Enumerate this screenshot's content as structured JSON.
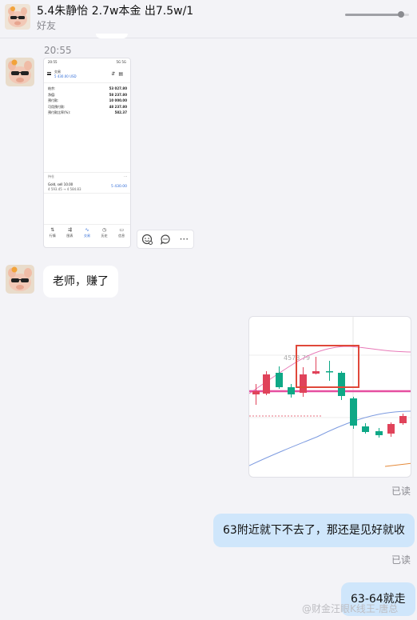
{
  "header": {
    "name": "5.4朱静怡 2.7w本金 出7.5w/1",
    "subtitle": "好友",
    "scroll_fraction": 0.88
  },
  "messages": {
    "time": "20:55",
    "reply_1": "老师，赚了",
    "reply_2": "63附近就下不去了，那还是见好就收",
    "reply_3": "63-64就走",
    "read_status_1": "已读",
    "read_status_2": "已读"
  },
  "phone_screenshot": {
    "status_time": "20:55",
    "status_right": "5G 5G",
    "title": "交易",
    "balance": "5 430.00 USD",
    "rows": [
      {
        "label": "结余:",
        "value": "53 027.80"
      },
      {
        "label": "净值:",
        "value": "58 237.80"
      },
      {
        "label": "预付款:",
        "value": "10 000.00"
      },
      {
        "label": "可用预付款:",
        "value": "48 237.80"
      },
      {
        "label": "预付款比率(%):",
        "value": "582.37"
      }
    ],
    "section_label": "持仓",
    "position": {
      "symbol": "Gold, sell 10.00",
      "prices": "4 593.45 → 4 584.83",
      "profit": "5 430.00"
    },
    "nav": [
      {
        "icon": "⇅",
        "label": "行情"
      },
      {
        "icon": "⇶",
        "label": "图表"
      },
      {
        "icon": "∿",
        "label": "交易"
      },
      {
        "icon": "◷",
        "label": "历史"
      },
      {
        "icon": "▭",
        "label": "信息"
      }
    ]
  },
  "chart_data": {
    "type": "candlestick",
    "annotation_price": "4573.79",
    "colors": {
      "up": "#e0435a",
      "down": "#0ea886",
      "ma_pink": "#e87ab8",
      "ma_blue": "#7d9be0",
      "highlight_box": "#e0483a",
      "level_line": "#e64fa0"
    }
  },
  "watermark": "@财金汪眼K线王-唐总"
}
